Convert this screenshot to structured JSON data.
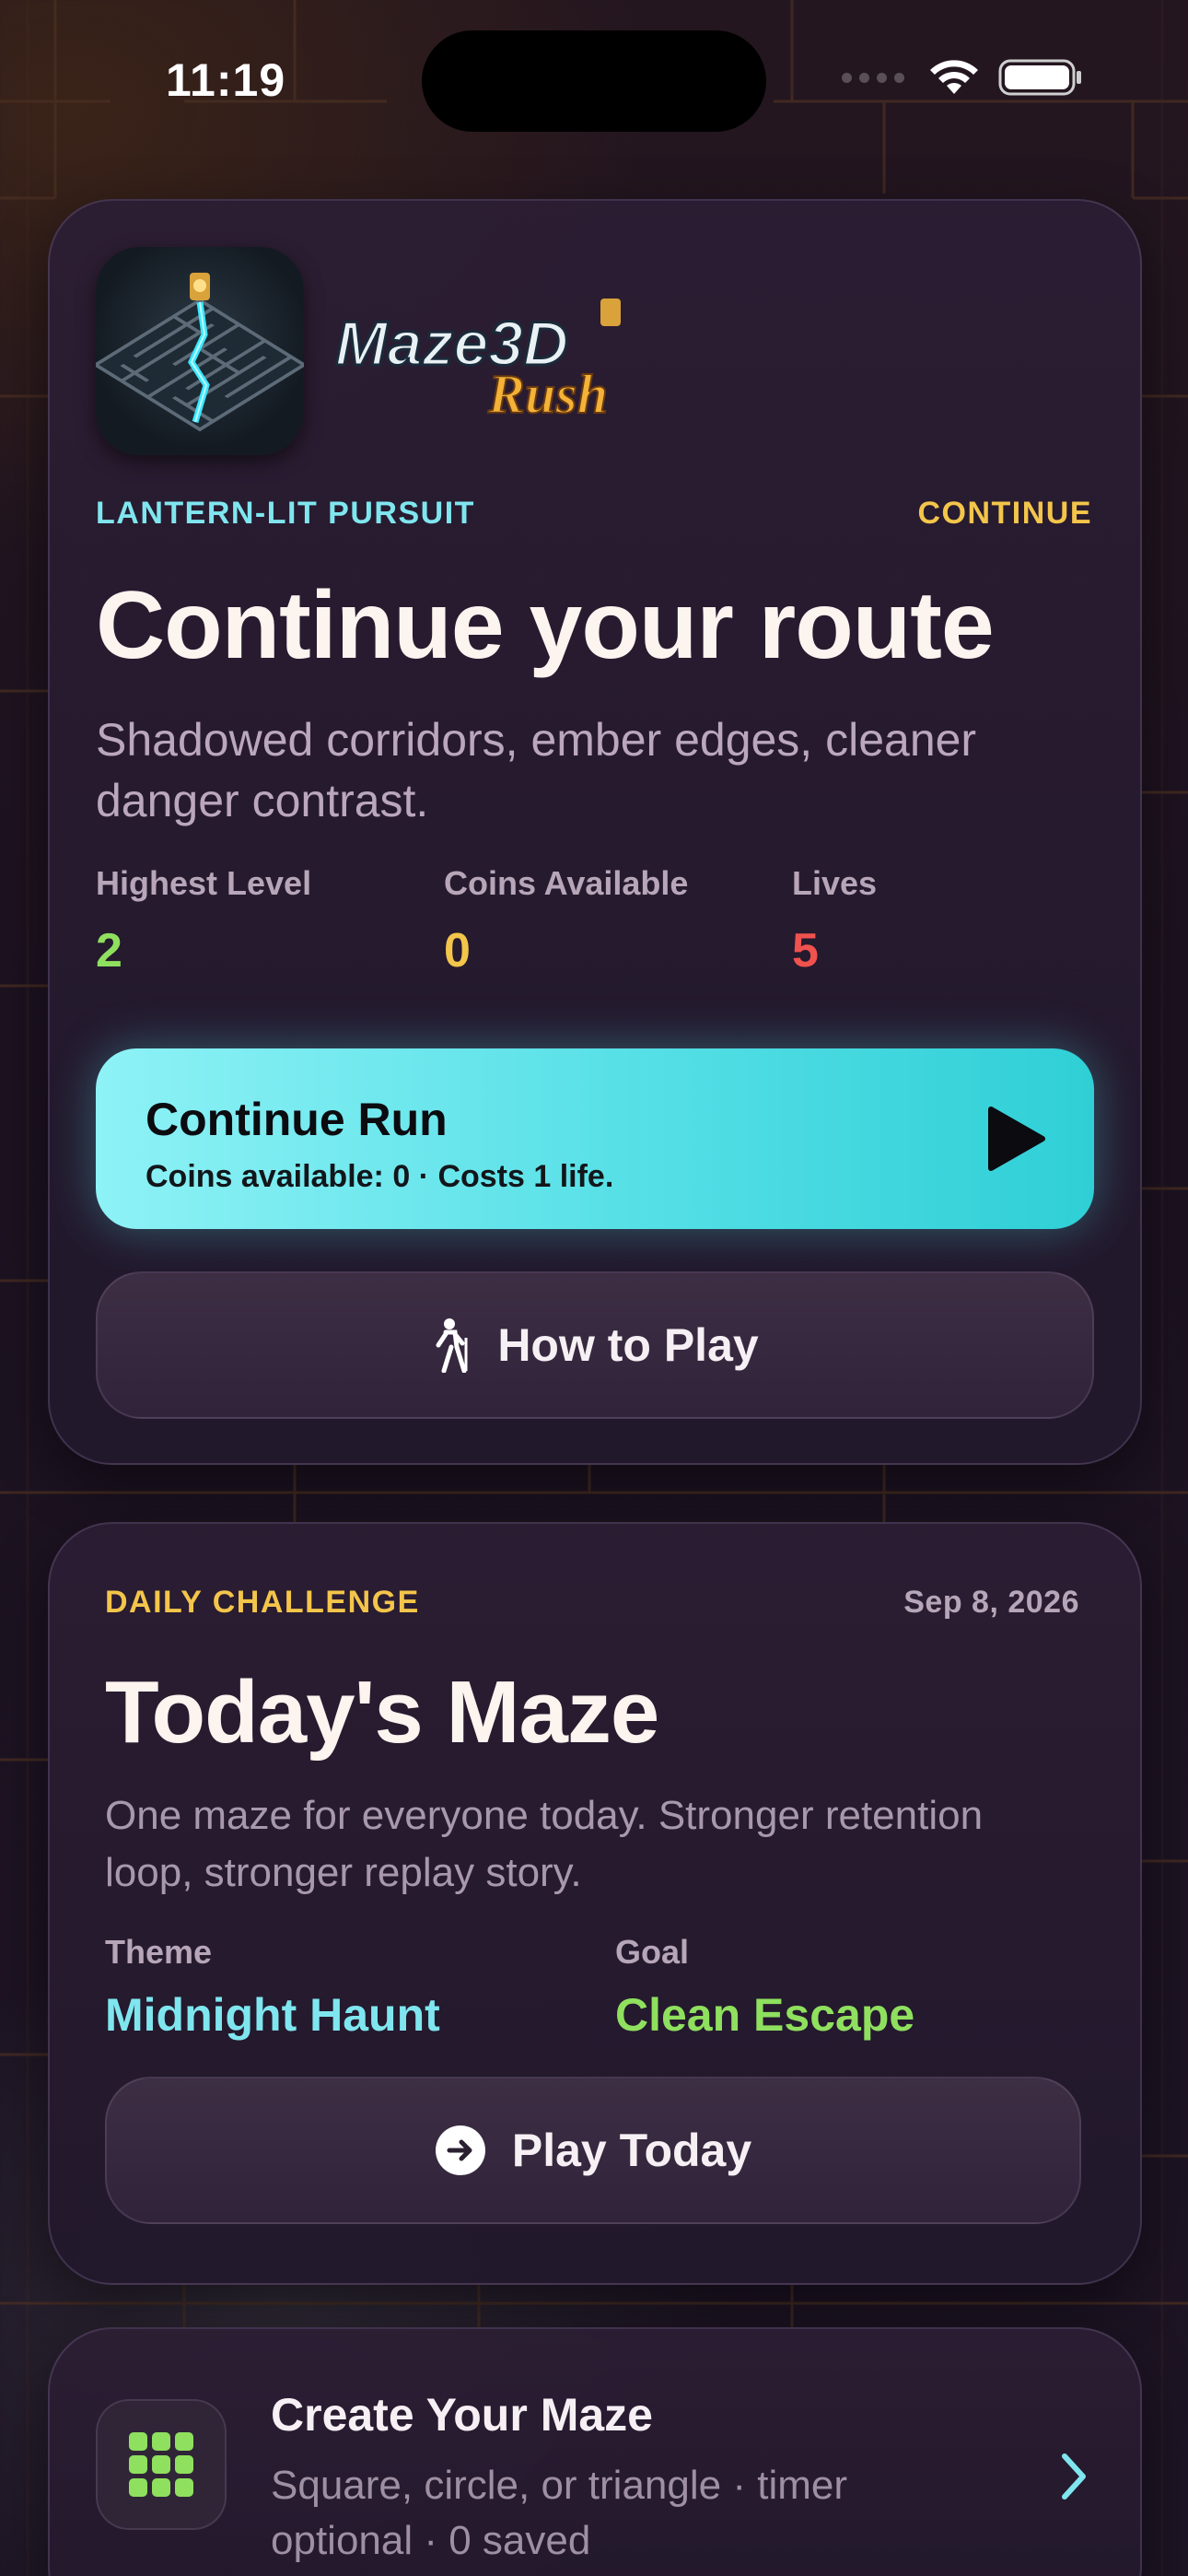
{
  "status": {
    "time": "11:19"
  },
  "hero": {
    "brand_title": "Maze3D",
    "brand_subtitle": "Rush",
    "eyebrow": "LANTERN-LIT PURSUIT",
    "action_label": "CONTINUE",
    "title": "Continue your route",
    "subtitle": "Shadowed corridors, ember edges, cleaner danger contrast.",
    "stats": [
      {
        "label": "Highest Level",
        "value": "2",
        "color": "#8fe05e"
      },
      {
        "label": "Coins Available",
        "value": "0",
        "color": "#f3c54a"
      },
      {
        "label": "Lives",
        "value": "5",
        "color": "#f0524e"
      }
    ],
    "continue_button": {
      "label": "Continue Run",
      "detail": "Coins available: 0 · Costs 1 life."
    },
    "how_to_play": "How to Play"
  },
  "daily": {
    "eyebrow": "DAILY CHALLENGE",
    "date": "Sep 8, 2026",
    "title": "Today's Maze",
    "subtitle": "One maze for everyone today. Stronger retention loop, stronger replay story.",
    "theme_label": "Theme",
    "theme_value": "Midnight Haunt",
    "goal_label": "Goal",
    "goal_value": "Clean Escape",
    "play_button": "Play Today"
  },
  "create": {
    "title": "Create Your Maze",
    "subtitle": "Square, circle, or triangle · timer optional · 0 saved"
  },
  "colors": {
    "accent_cyan": "#7fe6ef",
    "accent_gold": "#f3c54a",
    "accent_green": "#8fe05e",
    "danger_red": "#f0524e"
  }
}
